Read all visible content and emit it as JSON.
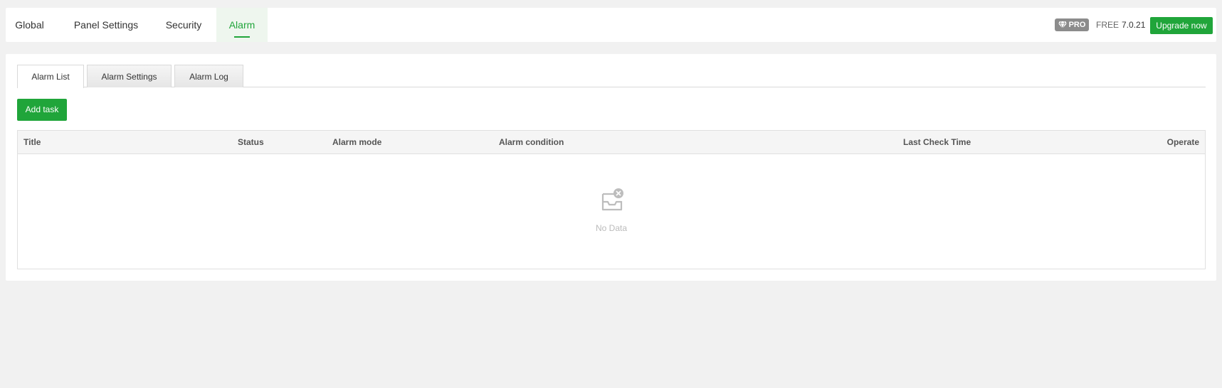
{
  "nav": {
    "tabs": [
      {
        "label": "Global"
      },
      {
        "label": "Panel Settings"
      },
      {
        "label": "Security"
      },
      {
        "label": "Alarm"
      }
    ],
    "active_tab": "Alarm"
  },
  "header": {
    "pro_badge": "PRO",
    "plan": "FREE",
    "version": "7.0.21",
    "upgrade_label": "Upgrade now"
  },
  "subtabs": [
    {
      "label": "Alarm List"
    },
    {
      "label": "Alarm Settings"
    },
    {
      "label": "Alarm Log"
    }
  ],
  "active_subtab": "Alarm List",
  "toolbar": {
    "add_label": "Add task"
  },
  "table": {
    "columns": [
      "Title",
      "Status",
      "Alarm mode",
      "Alarm condition",
      "Last Check Time",
      "Operate"
    ],
    "empty_text": "No Data"
  },
  "colors": {
    "accent": "#20a53a",
    "page_background": "#f1f1f1",
    "badge": "#8c8c8c"
  },
  "icons": {
    "pro": "gem-icon",
    "empty": "empty-inbox-icon"
  }
}
